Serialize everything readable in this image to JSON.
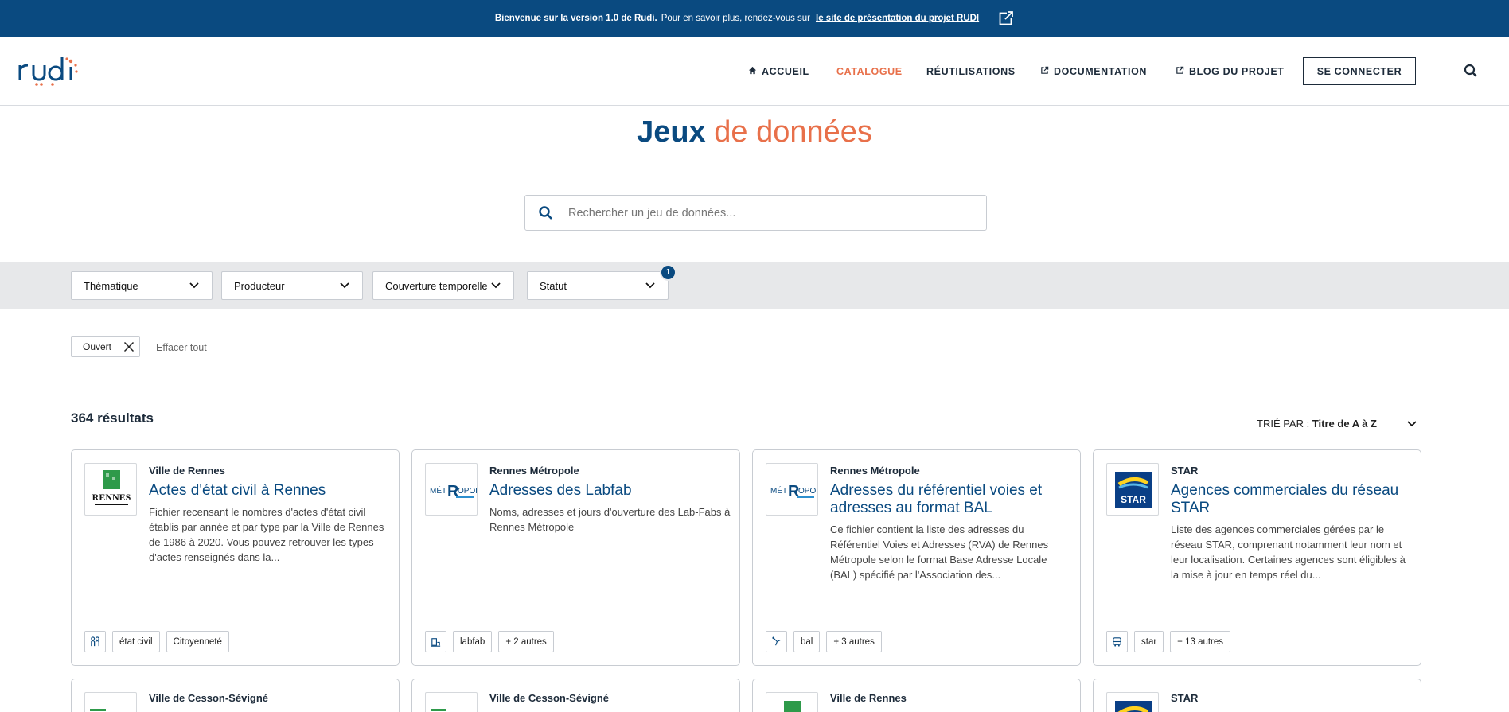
{
  "banner": {
    "bold": "Bienvenue sur la version 1.0 de Rudi.",
    "text": "Pour en savoir plus, rendez-vous sur",
    "link": "le site de présentation du projet RUDI",
    "icon": "external-link-icon"
  },
  "header": {
    "logo_text": "rudi",
    "nav": [
      {
        "label": "ACCUEIL",
        "icon": "home-icon"
      },
      {
        "label": "CATALOGUE"
      },
      {
        "label": "RÉUTILISATIONS"
      },
      {
        "label": "DOCUMENTATION",
        "icon": "external-link-icon"
      },
      {
        "label": "BLOG DU PROJET",
        "icon": "external-link-icon"
      }
    ],
    "login": "SE CONNECTER",
    "search_icon": "search-icon"
  },
  "page": {
    "title_bold": "Jeux",
    "title_rest": "de données",
    "search_placeholder": "Rechercher un jeu de données..."
  },
  "filters": {
    "items": [
      "Thématique",
      "Producteur",
      "Couverture temporelle",
      "Statut"
    ],
    "status_badge": "1",
    "active_chip": "Ouvert",
    "clear_all": "Effacer tout"
  },
  "results": {
    "count": "364 résultats",
    "sort_label": "TRIÉ PAR :",
    "sort_value": "Titre de A à Z"
  },
  "colors": {
    "primary": "#0a4a80",
    "accent": "#e8704a",
    "filterbar": "#e7e8ea"
  },
  "cards": [
    {
      "producer": "Ville de Rennes",
      "title": "Actes d'état civil à Rennes",
      "description": "Fichier recensant le nombres d'actes d'état civil établis par année et par type par la Ville de Rennes de 1986 à 2020. Vous pouvez retrouver les types d'actes renseignés dans la...",
      "tags": [
        "état civil",
        "Citoyenneté"
      ],
      "tag_icon": "people-icon"
    },
    {
      "producer": "Rennes Métropole",
      "title": "Adresses des Labfab",
      "description": "Noms, adresses et jours d'ouverture des Lab-Fabs à Rennes Métropole",
      "tags": [
        "labfab",
        "+ 2 autres"
      ],
      "tag_icon": "building-icon"
    },
    {
      "producer": "Rennes Métropole",
      "title": "Adresses du référentiel voies et adresses au format BAL",
      "description": "Ce fichier contient la liste des adresses du Référentiel Voies et Adresses (RVA) de Rennes Métropole selon le format Base Adresse Locale (BAL) spécifié par l'Association des...",
      "tags": [
        "bal",
        "+ 3 autres"
      ],
      "tag_icon": "map-pin-icon"
    },
    {
      "producer": "STAR",
      "title": "Agences commerciales du réseau STAR",
      "description": "Liste des agences commerciales gérées par le réseau STAR, comprenant notamment leur nom et leur localisation. Certaines agences sont éligibles à la mise à jour en temps réel du...",
      "tags": [
        "star",
        "+ 13 autres"
      ],
      "tag_icon": "bus-icon"
    }
  ],
  "cards_row2": [
    {
      "producer": "Ville de Cesson-Sévigné"
    },
    {
      "producer": "Ville de Cesson-Sévigné"
    },
    {
      "producer": "Ville de Rennes"
    },
    {
      "producer": "STAR"
    }
  ]
}
